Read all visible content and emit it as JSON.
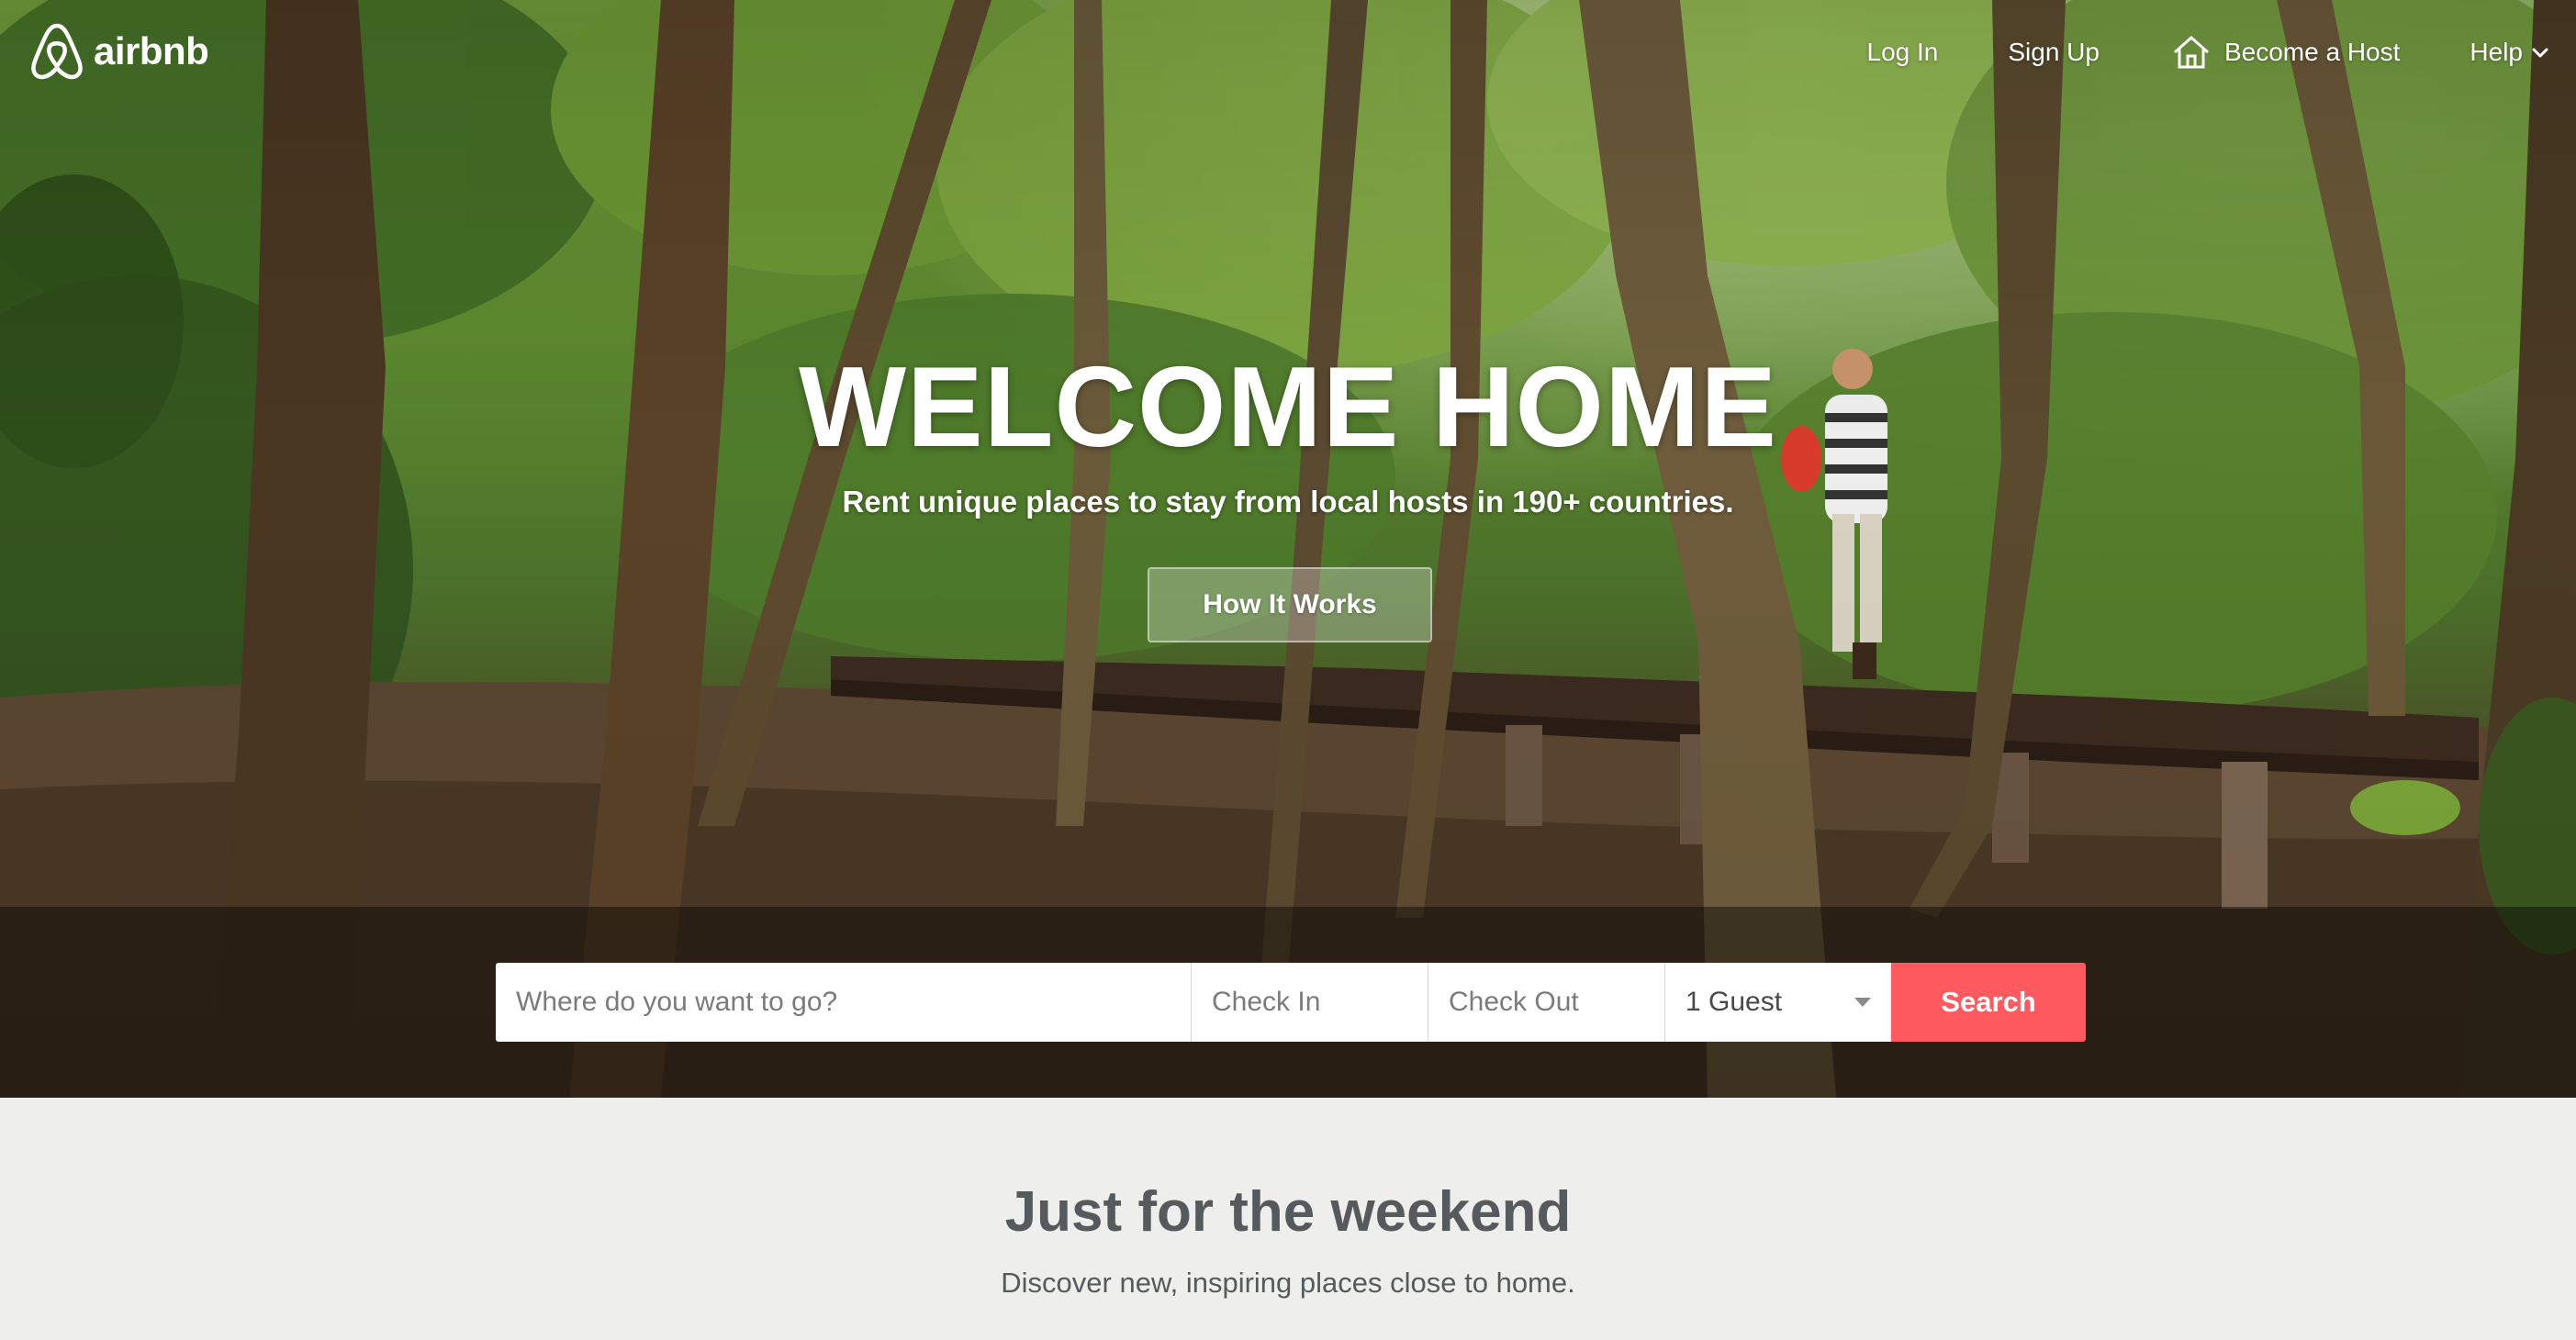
{
  "brand": {
    "name": "airbnb",
    "accent_color": "#ff5a5f"
  },
  "nav": {
    "login": "Log In",
    "signup": "Sign Up",
    "host": "Become a Host",
    "help": "Help",
    "host_icon": "house-icon",
    "help_icon": "chevron-down-icon"
  },
  "hero": {
    "title": "WELCOME HOME",
    "subtitle": "Rent unique places to stay from local hosts in 190+ countries.",
    "how_it_works": "How It Works"
  },
  "search": {
    "where_placeholder": "Where do you want to go?",
    "checkin_placeholder": "Check In",
    "checkout_placeholder": "Check Out",
    "guests_value": "1 Guest",
    "button_label": "Search"
  },
  "section": {
    "title": "Just for the weekend",
    "subtitle": "Discover new, inspiring places close to home."
  }
}
